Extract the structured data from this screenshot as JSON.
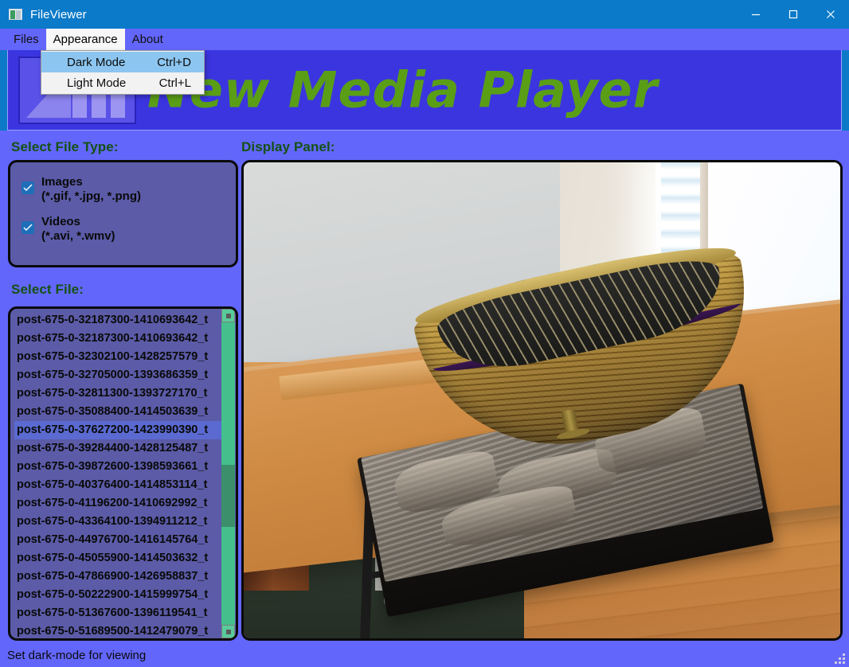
{
  "window": {
    "title": "FileViewer",
    "icon": "app-window-icon",
    "controls": {
      "minimize": "minimize-icon",
      "maximize": "maximize-icon",
      "close": "close-icon"
    }
  },
  "menubar": {
    "items": [
      {
        "label": "Files",
        "open": false
      },
      {
        "label": "Appearance",
        "open": true
      },
      {
        "label": "About",
        "open": false
      }
    ]
  },
  "dropdown": {
    "owner": "Appearance",
    "items": [
      {
        "label": "Dark Mode",
        "accel": "Ctrl+D",
        "highlighted": true
      },
      {
        "label": "Light Mode",
        "accel": "Ctrl+L",
        "highlighted": false
      }
    ]
  },
  "banner": {
    "title": "New Media Player",
    "title_color": "#5a9e16",
    "background": "#3b35e0",
    "logo": "media-player-logo"
  },
  "left_panel": {
    "filetype_label": "Select File Type:",
    "filetypes": [
      {
        "name": "Images",
        "extensions": "(*.gif, *.jpg, *.png)",
        "checked": true
      },
      {
        "name": "Videos",
        "extensions": "(*.avi, *.wmv)",
        "checked": true
      }
    ],
    "selectfile_label": "Select File:",
    "files": [
      {
        "name": "post-675-0-32187300-1410693642_t",
        "selected": false
      },
      {
        "name": "post-675-0-32187300-1410693642_t",
        "selected": false
      },
      {
        "name": "post-675-0-32302100-1428257579_t",
        "selected": false
      },
      {
        "name": "post-675-0-32705000-1393686359_t",
        "selected": false
      },
      {
        "name": "post-675-0-32811300-1393727170_t",
        "selected": false
      },
      {
        "name": "post-675-0-35088400-1414503639_t",
        "selected": false
      },
      {
        "name": "post-675-0-37627200-1423990390_t",
        "selected": true
      },
      {
        "name": "post-675-0-39284400-1428125487_t",
        "selected": false
      },
      {
        "name": "post-675-0-39872600-1398593661_t",
        "selected": false
      },
      {
        "name": "post-675-0-40376400-1414853114_t",
        "selected": false
      },
      {
        "name": "post-675-0-41196200-1410692992_t",
        "selected": false
      },
      {
        "name": "post-675-0-43364100-1394911212_t",
        "selected": false
      },
      {
        "name": "post-675-0-44976700-1416145764_t",
        "selected": false
      },
      {
        "name": "post-675-0-45055900-1414503632_t",
        "selected": false
      },
      {
        "name": "post-675-0-47866900-1426958837_t",
        "selected": false
      },
      {
        "name": "post-675-0-50222900-1415999754_t",
        "selected": false
      },
      {
        "name": "post-675-0-51367600-1396119541_t",
        "selected": false
      },
      {
        "name": "post-675-0-51689500-1412479079_t",
        "selected": false
      }
    ],
    "scrollbar": {
      "up": "scroll-up-icon",
      "down": "scroll-down-icon"
    }
  },
  "right_panel": {
    "display_label": "Display Panel:",
    "image_description": "Model wooden rowboat on a driftwood base sitting on a wooden table near a bright window"
  },
  "statusbar": {
    "text": "Set dark-mode for viewing",
    "grip": "resize-grip-icon"
  },
  "colors": {
    "accent": "#6366fa",
    "banner": "#3b35e0",
    "titlebar": "#0b7ac9",
    "label_green": "#145214",
    "panel_fill": "#5b5ba8",
    "scrollbar": "#45c08d"
  }
}
